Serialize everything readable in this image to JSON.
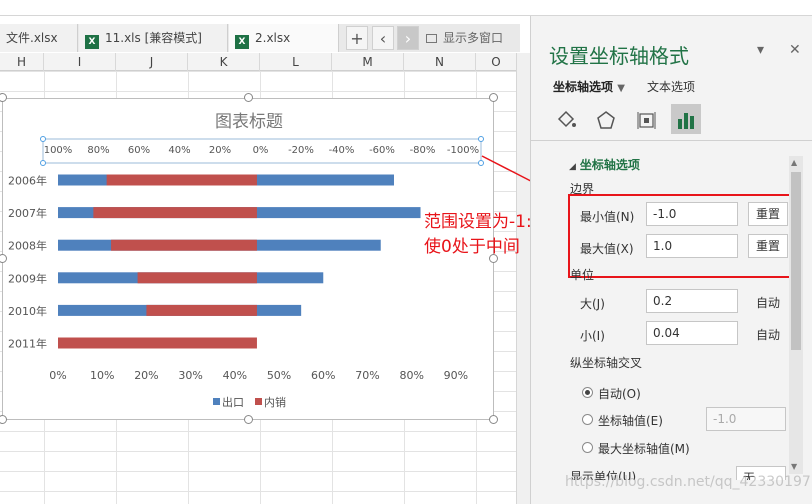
{
  "tabs": [
    {
      "label": "文件.xlsx"
    },
    {
      "label": "11.xls  [兼容模式]"
    },
    {
      "label": "2.xlsx"
    }
  ],
  "tab_controls": {
    "add": "+",
    "prev": "‹",
    "next": "›",
    "multi_window": "显示多窗口"
  },
  "columns": [
    "H",
    "I",
    "J",
    "K",
    "L",
    "M",
    "N",
    "O"
  ],
  "chart_data": {
    "type": "bar",
    "title": "图表标题",
    "categories": [
      "2006年",
      "2007年",
      "2008年",
      "2009年",
      "2010年",
      "2011年"
    ],
    "series": [
      {
        "name": "出口",
        "values": [
          0.76,
          0.82,
          0.73,
          0.6,
          0.55,
          0.14
        ]
      },
      {
        "name": "内销",
        "values": [
          0.34,
          0.37,
          0.33,
          0.27,
          0.25,
          0.45
        ]
      }
    ],
    "xlim": [
      0,
      0.95
    ],
    "xticks": [
      "0%",
      "10%",
      "20%",
      "30%",
      "40%",
      "50%",
      "60%",
      "70%",
      "80%",
      "90%"
    ],
    "secondary_axis": {
      "range": [
        1,
        -1
      ],
      "ticks": [
        "100%",
        "80%",
        "60%",
        "40%",
        "20%",
        "0%",
        "-20%",
        "-40%",
        "-60%",
        "-80%",
        "-100%"
      ],
      "placement": "top"
    },
    "legend": "bottom",
    "colors": {
      "出口": "#4f81bd",
      "内销": "#c0504d"
    }
  },
  "callout": {
    "line1": "范围设置为-1:1",
    "line2": "使0处于中间"
  },
  "panel": {
    "title": "设置坐标轴格式",
    "tab_axis": "坐标轴选项",
    "tab_text": "文本选项",
    "section": "坐标轴选项",
    "bounds_label": "边界",
    "min_label": "最小值(N)",
    "min_value": "-1.0",
    "max_label": "最大值(X)",
    "max_value": "1.0",
    "reset": "重置",
    "units_label": "单位",
    "major_label": "大(J)",
    "major_value": "0.2",
    "minor_label": "小(I)",
    "minor_value": "0.04",
    "auto": "自动",
    "cross_label": "纵坐标轴交叉",
    "radio_auto": "自动(O)",
    "radio_value": "坐标轴值(E)",
    "radio_value_input": "-1.0",
    "radio_max": "最大坐标轴值(M)",
    "display_units": "显示单位(U)",
    "display_units_value": "无"
  },
  "watermark": "https://blog.csdn.net/qq_42330197"
}
